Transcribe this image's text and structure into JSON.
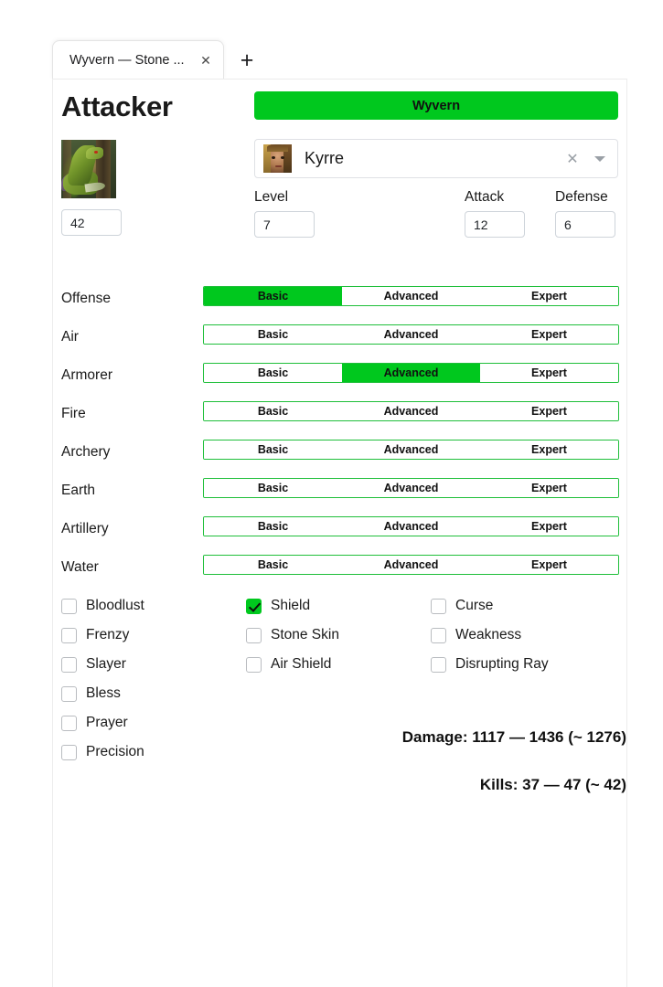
{
  "browser": {
    "tab": {
      "title": "Wyvern — Stone ...",
      "close_icon": "close-icon"
    },
    "new_tab_label": "+"
  },
  "page": {
    "title": "Attacker",
    "creature": {
      "name": "Wyvern",
      "image_alt": "wyvern-thumbnail",
      "count": "42"
    },
    "hero": {
      "name": "Kyrre",
      "avatar_alt": "kyrre-portrait",
      "clear_icon": "close-icon",
      "dropdown_icon": "caret-down-icon"
    },
    "stats": [
      {
        "key": "level",
        "label": "Level",
        "value": "7"
      },
      {
        "key": "attack",
        "label": "Attack",
        "value": "12"
      },
      {
        "key": "defense",
        "label": "Defense",
        "value": "6"
      }
    ],
    "skill_levels": [
      "Basic",
      "Advanced",
      "Expert"
    ],
    "skills": [
      {
        "name": "Offense",
        "selected": "Basic"
      },
      {
        "name": "Air",
        "selected": null
      },
      {
        "name": "Armorer",
        "selected": "Advanced"
      },
      {
        "name": "Fire",
        "selected": null
      },
      {
        "name": "Archery",
        "selected": null
      },
      {
        "name": "Earth",
        "selected": null
      },
      {
        "name": "Artillery",
        "selected": null
      },
      {
        "name": "Water",
        "selected": null
      }
    ],
    "spell_columns": [
      [
        {
          "label": "Bloodlust",
          "checked": false
        },
        {
          "label": "Frenzy",
          "checked": false
        },
        {
          "label": "Slayer",
          "checked": false
        },
        {
          "label": "Bless",
          "checked": false
        },
        {
          "label": "Prayer",
          "checked": false
        },
        {
          "label": "Precision",
          "checked": false
        }
      ],
      [
        {
          "label": "Shield",
          "checked": true
        },
        {
          "label": "Stone Skin",
          "checked": false
        },
        {
          "label": "Air Shield",
          "checked": false
        }
      ],
      [
        {
          "label": "Curse",
          "checked": false
        },
        {
          "label": "Weakness",
          "checked": false
        },
        {
          "label": "Disrupting Ray",
          "checked": false
        }
      ]
    ],
    "results": {
      "damage": "Damage: 1117 — 1436 (~ 1276)",
      "kills": "Kills: 37 — 47 (~ 42)"
    }
  },
  "colors": {
    "accent_green": "#00c81e",
    "border_green": "#1fbf3a",
    "text": "#1a1a1a",
    "input_border": "#ced4da"
  }
}
